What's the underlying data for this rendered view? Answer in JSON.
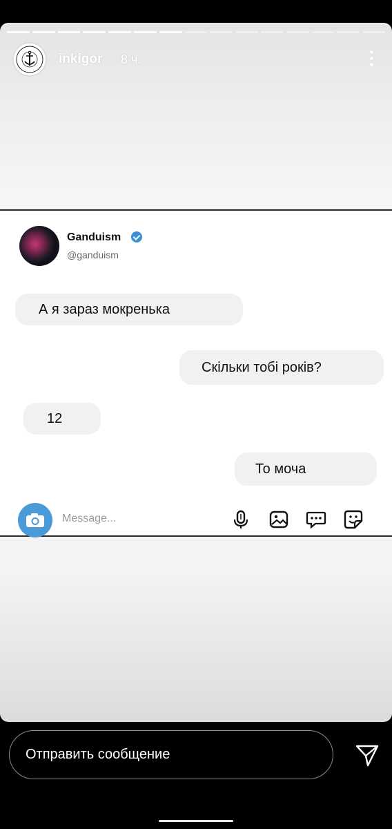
{
  "story": {
    "username": "inkigor",
    "time": "8 ч.",
    "progress_segments": 15,
    "progress_completed": 7,
    "avatar_logo_text": [
      "INK ME ART",
      "TATTOO STUDIO"
    ]
  },
  "screenshot": {
    "profile_name": "Ganduism",
    "profile_handle": "@ganduism",
    "messages": [
      {
        "side": "incoming",
        "text": "А я зараз мокренька"
      },
      {
        "side": "outgoing",
        "text": "Скільки тобі років?"
      },
      {
        "side": "incoming",
        "text": "12"
      },
      {
        "side": "outgoing",
        "text": "То моча"
      }
    ],
    "composer": {
      "placeholder": "Message...",
      "icons": [
        "camera-icon",
        "microphone-icon",
        "image-icon",
        "chat-icon",
        "sticker-icon"
      ]
    }
  },
  "reply": {
    "placeholder": "Отправить сообщение",
    "send_icon": "send-icon"
  },
  "colors": {
    "background": "#000000",
    "verified": "#3b8fd6",
    "camera_button": "#4a9ad8",
    "bubble": "#f1f1f1"
  }
}
